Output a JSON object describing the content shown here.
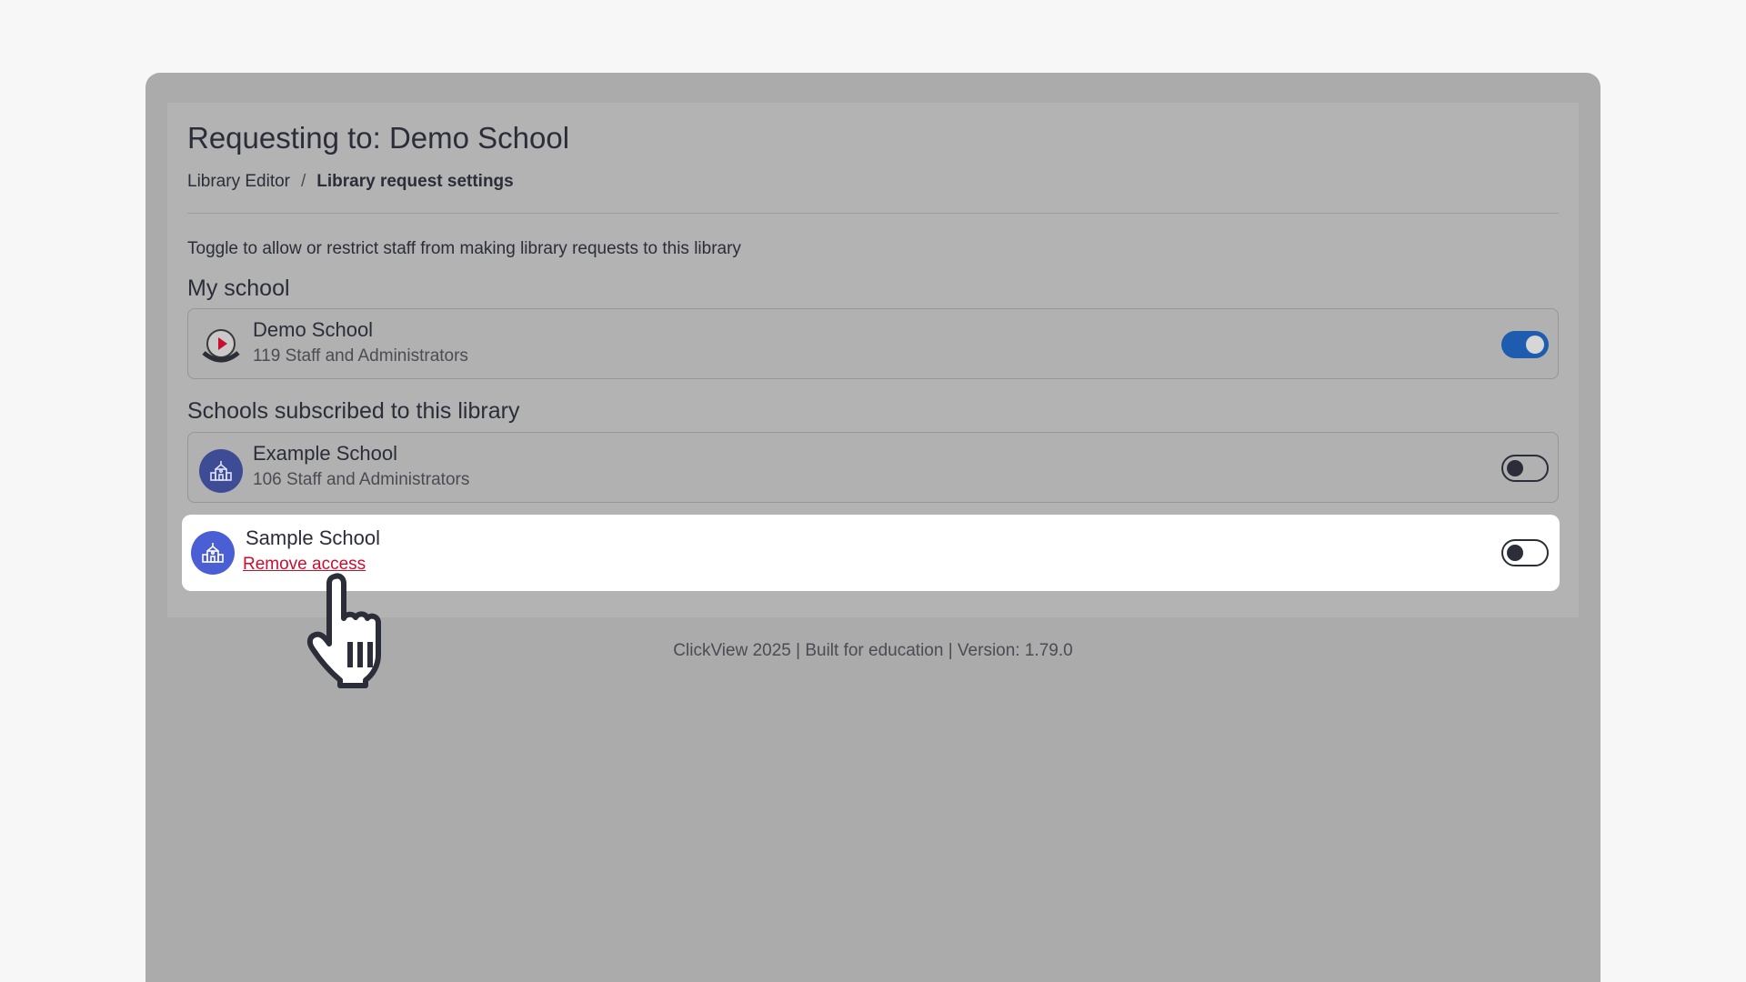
{
  "page": {
    "title": "Requesting to: Demo School",
    "breadcrumb": {
      "parent": "Library Editor",
      "separator": "/",
      "current": "Library request settings"
    },
    "description": "Toggle to allow or restrict staff from making library requests to this library"
  },
  "my_school": {
    "heading": "My school",
    "school": {
      "name": "Demo School",
      "subtitle": "119 Staff and Administrators",
      "icon": "clickview-logo-icon",
      "toggle_on": true
    }
  },
  "subscribed": {
    "heading": "Schools subscribed to this library",
    "schools": [
      {
        "name": "Example School",
        "subtitle": "106 Staff and Administrators",
        "icon": "school-building-icon",
        "toggle_on": false
      },
      {
        "name": "Sample School",
        "action": "Remove access",
        "icon": "school-building-icon",
        "toggle_on": false
      }
    ]
  },
  "footer": {
    "text": "ClickView 2025 | Built for education | Version: 1.79.0"
  },
  "colors": {
    "toggle_on": "#1d5cae",
    "school_avatar": "#3d4c95",
    "highlight_avatar": "#4a5fd4",
    "remove_link": "#c8102e",
    "overlay": "#ababab"
  },
  "cursor": {
    "icon": "hand-pointer-icon"
  }
}
